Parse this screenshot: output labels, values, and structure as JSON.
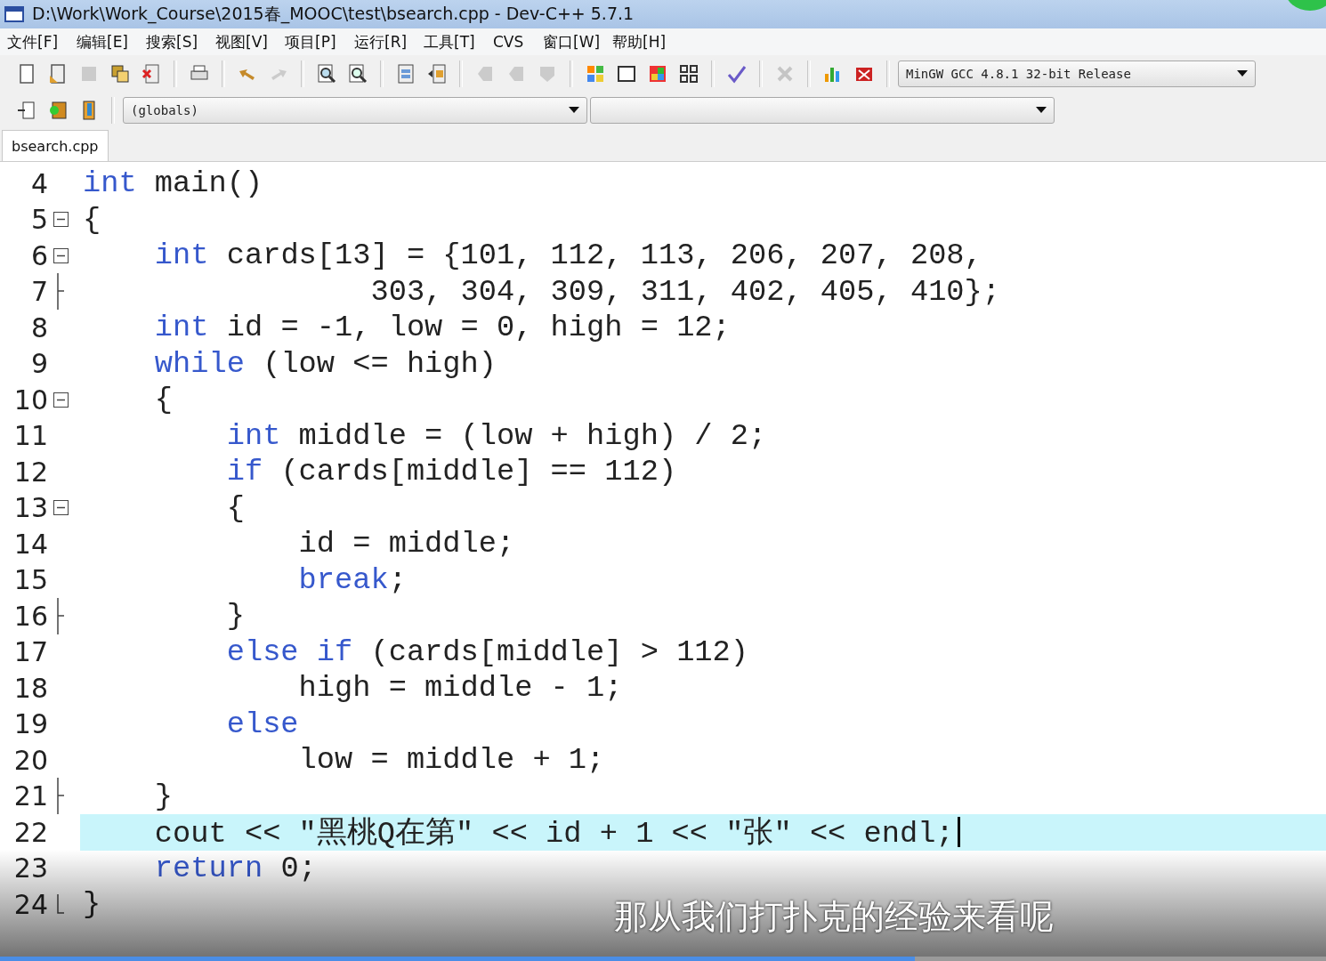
{
  "window": {
    "title": "D:\\Work\\Work_Course\\2015春_MOOC\\test\\bsearch.cpp - Dev-C++ 5.7.1"
  },
  "menu": [
    "文件[F]",
    "编辑[E]",
    "搜索[S]",
    "视图[V]",
    "项目[P]",
    "运行[R]",
    "工具[T]",
    "CVS",
    "窗口[W]",
    "帮助[H]"
  ],
  "toolbar": {
    "buttons": [
      {
        "disabled": false
      },
      {
        "disabled": false
      },
      {
        "disabled": true
      },
      {
        "disabled": false
      },
      {
        "disabled": false
      },
      {
        "disabled": false
      },
      {
        "disabled": false
      },
      {
        "disabled": true
      },
      {
        "disabled": false
      },
      {
        "disabled": false
      },
      {
        "disabled": false
      },
      {
        "disabled": false
      },
      {
        "disabled": true
      },
      {
        "disabled": true
      },
      {
        "disabled": true
      },
      {
        "disabled": false
      },
      {
        "disabled": false
      },
      {
        "disabled": false
      },
      {
        "disabled": false
      },
      {
        "disabled": false
      },
      {
        "disabled": true
      },
      {
        "disabled": false
      },
      {
        "disabled": false
      }
    ],
    "compiler": "MinGW GCC 4.8.1 32-bit Release"
  },
  "class_bar": {
    "scope": "(globals)"
  },
  "tabs": [
    {
      "label": "bsearch.cpp",
      "selected": true
    }
  ],
  "editor": {
    "lines": [
      {
        "number": "4",
        "kind": "plain",
        "selected": false,
        "tokens": [
          {
            "kind": "keyword",
            "text": "int"
          },
          {
            "kind": "text",
            "text": " main()"
          }
        ]
      },
      {
        "number": "5",
        "kind": "open",
        "selected": false,
        "tokens": [
          {
            "kind": "text",
            "text": "{"
          }
        ]
      },
      {
        "number": "6",
        "kind": "open",
        "selected": false,
        "tokens": [
          {
            "kind": "keyword",
            "text": "    int"
          },
          {
            "kind": "text",
            "text": " cards[13] = {101, 112, 113, 206, 207, 208,"
          }
        ]
      },
      {
        "number": "7",
        "kind": "end",
        "selected": false,
        "tokens": [
          {
            "kind": "text",
            "text": "                303, 304, 309, 311, 402, 405, 410};"
          }
        ]
      },
      {
        "number": "8",
        "kind": "plain",
        "selected": false,
        "tokens": [
          {
            "kind": "keyword",
            "text": "    int"
          },
          {
            "kind": "text",
            "text": " id = -1, low = 0, high = 12;"
          }
        ]
      },
      {
        "number": "9",
        "kind": "plain",
        "selected": false,
        "tokens": [
          {
            "kind": "keyword",
            "text": "    while"
          },
          {
            "kind": "text",
            "text": " (low <= high)"
          }
        ]
      },
      {
        "number": "10",
        "kind": "open",
        "selected": false,
        "tokens": [
          {
            "kind": "text",
            "text": "    {"
          }
        ]
      },
      {
        "number": "11",
        "kind": "plain",
        "selected": false,
        "tokens": [
          {
            "kind": "keyword",
            "text": "        int"
          },
          {
            "kind": "text",
            "text": " middle = (low + high) / 2;"
          }
        ]
      },
      {
        "number": "12",
        "kind": "plain",
        "selected": false,
        "tokens": [
          {
            "kind": "keyword",
            "text": "        if"
          },
          {
            "kind": "text",
            "text": " (cards[middle] == 112)"
          }
        ]
      },
      {
        "number": "13",
        "kind": "open",
        "selected": false,
        "tokens": [
          {
            "kind": "text",
            "text": "        {"
          }
        ]
      },
      {
        "number": "14",
        "kind": "plain",
        "selected": false,
        "tokens": [
          {
            "kind": "text",
            "text": "            id = middle;"
          }
        ]
      },
      {
        "number": "15",
        "kind": "plain",
        "selected": false,
        "tokens": [
          {
            "kind": "keyword",
            "text": "            break"
          },
          {
            "kind": "text",
            "text": ";"
          }
        ]
      },
      {
        "number": "16",
        "kind": "end",
        "selected": false,
        "tokens": [
          {
            "kind": "text",
            "text": "        }"
          }
        ]
      },
      {
        "number": "17",
        "kind": "plain",
        "selected": false,
        "tokens": [
          {
            "kind": "keyword",
            "text": "        else if"
          },
          {
            "kind": "text",
            "text": " (cards[middle] > 112)"
          }
        ]
      },
      {
        "number": "18",
        "kind": "plain",
        "selected": false,
        "tokens": [
          {
            "kind": "text",
            "text": "            high = middle - 1;"
          }
        ]
      },
      {
        "number": "19",
        "kind": "plain",
        "selected": false,
        "tokens": [
          {
            "kind": "keyword",
            "text": "        else"
          }
        ]
      },
      {
        "number": "20",
        "kind": "plain",
        "selected": false,
        "tokens": [
          {
            "kind": "text",
            "text": "            low = middle + 1;"
          }
        ]
      },
      {
        "number": "21",
        "kind": "end",
        "selected": false,
        "tokens": [
          {
            "kind": "text",
            "text": "    }"
          }
        ]
      },
      {
        "number": "22",
        "kind": "plain",
        "selected": true,
        "tokens": [
          {
            "kind": "text",
            "text": "    cout << \"黑桃Q在第\" << id + 1 << \"张\" << endl;"
          }
        ]
      },
      {
        "number": "23",
        "kind": "plain",
        "selected": false,
        "tokens": [
          {
            "kind": "keyword",
            "text": "    return"
          },
          {
            "kind": "text",
            "text": " 0;"
          }
        ]
      },
      {
        "number": "24",
        "kind": "last",
        "selected": false,
        "tokens": [
          {
            "kind": "text",
            "text": "}"
          }
        ]
      }
    ]
  },
  "subtitle": "那从我们打扑克的经验来看呢",
  "video_progress": {
    "level": 0.69
  }
}
